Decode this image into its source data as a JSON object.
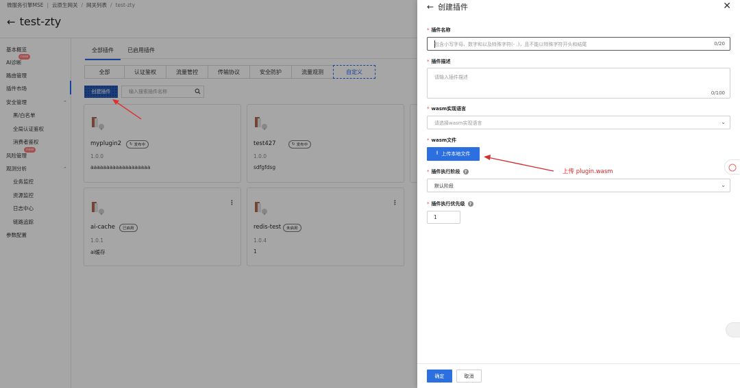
{
  "breadcrumb": [
    "微服务引擎MSE",
    "云原生网关",
    "网关列表",
    "test-zty"
  ],
  "page_title": "test-zty",
  "sidebar": {
    "items": [
      {
        "label": "基本概览"
      },
      {
        "label": "AI诊断",
        "badge": "new"
      },
      {
        "label": "路由管理"
      },
      {
        "label": "插件市场"
      },
      {
        "label": "安全管理"
      },
      {
        "label": "黑/白名单"
      },
      {
        "label": "全局认证鉴权"
      },
      {
        "label": "消费者鉴权"
      },
      {
        "label": "风险管理",
        "badge": "new"
      },
      {
        "label": "观测分析"
      },
      {
        "label": "业务监控"
      },
      {
        "label": "资源监控"
      },
      {
        "label": "日志中心"
      },
      {
        "label": "链路追踪"
      },
      {
        "label": "参数配置"
      }
    ]
  },
  "main": {
    "tabs": [
      "全部插件",
      "已启用插件"
    ],
    "categories": [
      "全部",
      "认证鉴权",
      "流量管控",
      "传输协议",
      "安全防护",
      "流量观测",
      "自定义"
    ],
    "create_label": "创建插件",
    "search_placeholder": "输入搜索插件名称",
    "cards": [
      {
        "name": "myplugin2",
        "status": "发布中",
        "version": "1.0.0",
        "desc": "aaaaaaaaaaaaaaaaaaa"
      },
      {
        "name": "test427",
        "status": "发布中",
        "version": "1.0.0",
        "desc": "sdfgfdsg"
      },
      {
        "name": "ai-cache",
        "status": "已启用",
        "version": "1.0.1",
        "desc": "ai缓存"
      },
      {
        "name": "redis-test",
        "status": "未启用",
        "version": "1.0.4",
        "desc": "1"
      }
    ]
  },
  "drawer": {
    "title": "创建插件",
    "name_label": "插件名称",
    "name_placeholder": "包含小写字母、数字和以及特殊字符(- .)，且不能以特殊字符开头和结尾",
    "name_count": "0/20",
    "desc_label": "插件描述",
    "desc_placeholder": "请输入插件描述",
    "desc_count": "0/100",
    "lang_label": "wasm实现语言",
    "lang_placeholder": "请选择wasm实现语言",
    "file_label": "wasm文件",
    "upload_label": "上传本地文件",
    "annotation": "上传 plugin.wasm",
    "phase_label": "插件执行阶段",
    "phase_value": "默认阶段",
    "priority_label": "插件执行优先级",
    "priority_value": "1",
    "ok_label": "确定",
    "cancel_label": "取消"
  },
  "colors": {
    "primary": "#2b6fe0",
    "annotation": "#e02020",
    "required": "#ff3333"
  }
}
